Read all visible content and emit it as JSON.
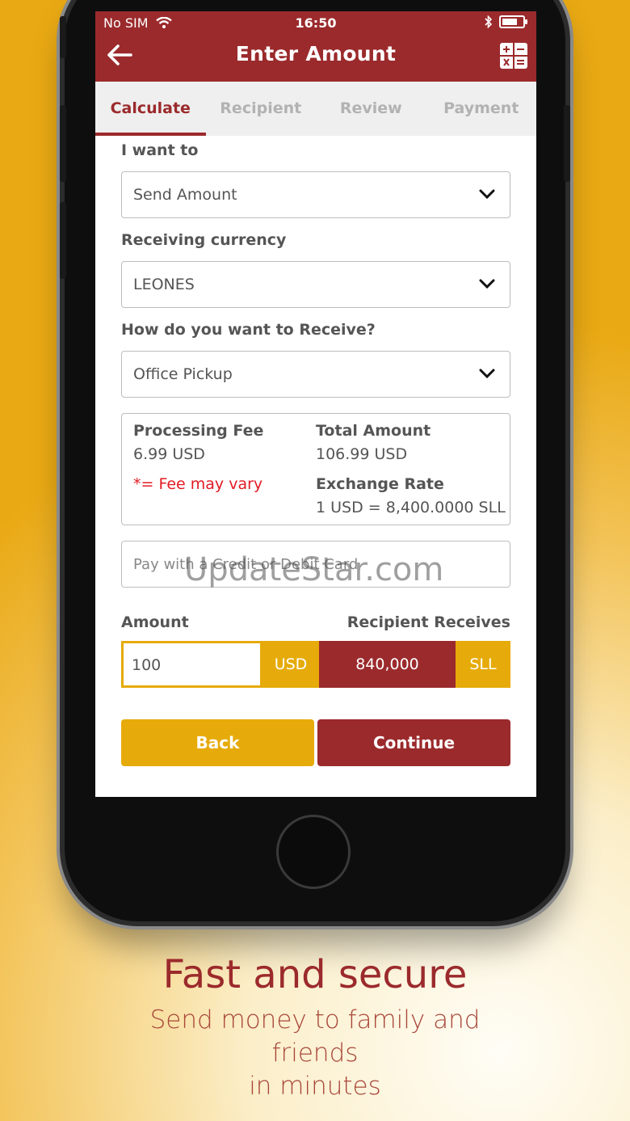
{
  "status_bar": {
    "carrier": "No SIM",
    "time": "16:50"
  },
  "header": {
    "title": "Enter Amount"
  },
  "tabs": [
    {
      "label": "Calculate",
      "active": true
    },
    {
      "label": "Recipient",
      "active": false
    },
    {
      "label": "Review",
      "active": false
    },
    {
      "label": "Payment",
      "active": false
    }
  ],
  "form": {
    "intent_label": "I want to",
    "intent_value": "Send Amount",
    "currency_label": "Receiving currency",
    "currency_value": "LEONES",
    "method_label": "How do you want to Receive?",
    "method_value": "Office Pickup"
  },
  "fees": {
    "processing_fee_label": "Processing Fee",
    "processing_fee_value": "6.99 USD",
    "fee_note": "*= Fee may vary",
    "total_label": "Total Amount",
    "total_value": "106.99 USD",
    "rate_label": "Exchange Rate",
    "rate_value": "1 USD = 8,400.0000 SLL"
  },
  "payment": {
    "placeholder": "Pay with a Credit or Debit Card"
  },
  "watermark": "UpdateStar.com",
  "amount": {
    "amount_label": "Amount",
    "receives_label": "Recipient Receives",
    "amount_value": "100",
    "send_currency": "USD",
    "receive_value": "840,000",
    "receive_currency": "SLL"
  },
  "buttons": {
    "back": "Back",
    "continue": "Continue"
  },
  "caption": {
    "headline": "Fast and secure",
    "line1": "Send money to family and friends",
    "line2": "in minutes"
  },
  "colors": {
    "brand": "#9b2a2c",
    "accent": "#e6ab0a",
    "alert": "#e21b23"
  },
  "battery_level": 0.75
}
